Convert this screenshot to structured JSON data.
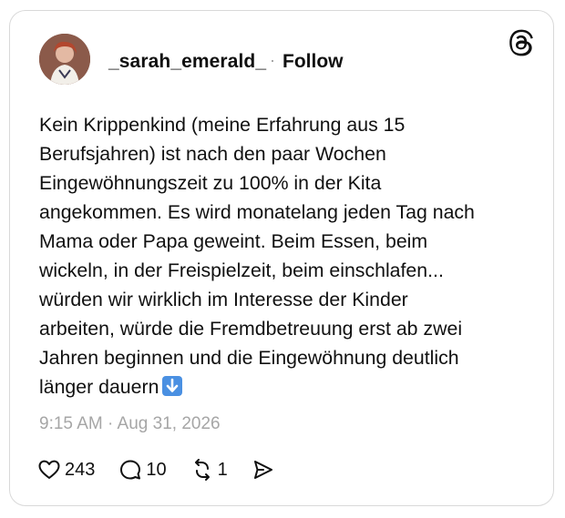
{
  "post": {
    "username": "_sarah_emerald_",
    "separator": "·",
    "follow_label": "Follow",
    "body_lines": [
      "Kein Krippenkind (meine Erfahrung aus 15",
      "Berufsjahren) ist nach den paar Wochen",
      "Eingewöhnungszeit zu 100% in der Kita",
      "angekommen. Es wird monatelang jeden Tag nach",
      "Mama oder Papa geweint. Beim Essen, beim",
      "wickeln, in der Freispielzeit, beim einschlafen...",
      "würden wir wirklich im Interesse der Kinder",
      "arbeiten, würde die Fremdbetreuung erst ab zwei",
      "Jahren beginnen und die Eingewöhnung deutlich",
      "länger dauern"
    ],
    "trailing_emoji": "down-arrow-emoji",
    "timestamp": "9:15 AM · Aug 31, 2026",
    "likes": "243",
    "replies": "10",
    "reposts": "1"
  },
  "icons": {
    "logo": "threads-logo-icon",
    "like": "heart-icon",
    "reply": "speech-bubble-icon",
    "repost": "repost-icon",
    "share": "send-icon"
  },
  "colors": {
    "text": "#101010",
    "muted": "#a6a6a6",
    "border": "#d9d9d9",
    "emoji_blue": "#4a90e2"
  }
}
